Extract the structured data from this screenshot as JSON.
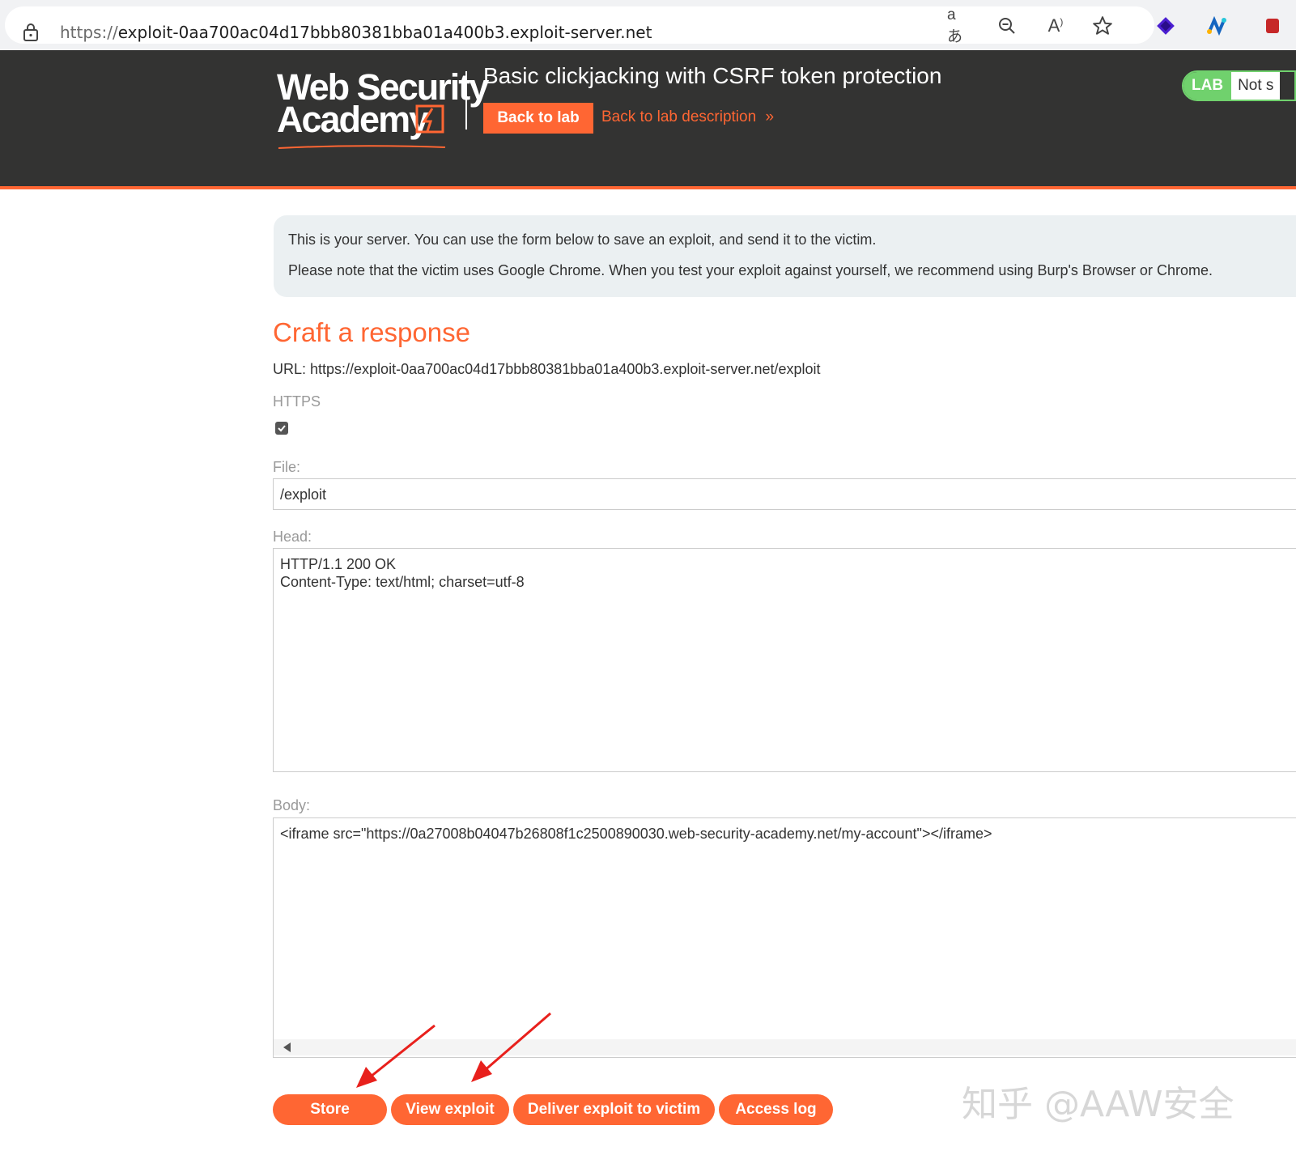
{
  "browser": {
    "url_scheme": "https://",
    "url_host": "exploit-0aa700ac04d17bbb80381bba01a400b3.exploit-server.net",
    "translate_glyph": "aあ",
    "read_aloud_glyph": "A"
  },
  "header": {
    "logo_line1": "Web Security",
    "logo_line2": "Academy",
    "lab_title": "Basic clickjacking with CSRF token protection",
    "back_to_lab": "Back to lab",
    "back_to_description": "Back to lab description",
    "chevron": "»",
    "badge_label": "LAB",
    "badge_status": "Not s"
  },
  "info": {
    "line1": "This is your server. You can use the form below to save an exploit, and send it to the victim.",
    "line2": "Please note that the victim uses Google Chrome. When you test your exploit against yourself, we recommend using Burp's Browser or Chrome."
  },
  "form": {
    "title": "Craft a response",
    "url_line": "URL: https://exploit-0aa700ac04d17bbb80381bba01a400b3.exploit-server.net/exploit",
    "https_label": "HTTPS",
    "https_checked": true,
    "file_label": "File:",
    "file_value": "/exploit",
    "head_label": "Head:",
    "head_lines": [
      "HTTP/1.1 200 OK",
      "Content-Type: text/html; charset=utf-8"
    ],
    "body_label": "Body:",
    "body_value": "<iframe src=\"https://0a27008b04047b26808f1c2500890030.web-security-academy.net/my-account\"></iframe>"
  },
  "actions": {
    "store": "Store",
    "view_exploit": "View exploit",
    "deliver": "Deliver exploit to victim",
    "access_log": "Access log"
  },
  "watermark": "知乎 @AAW安全",
  "colors": {
    "accent": "#ff6633",
    "header_bg": "#333332",
    "lab_green": "#70d16d",
    "info_bg": "#ebf0f2",
    "annotation_arrow": "#e8201c"
  }
}
